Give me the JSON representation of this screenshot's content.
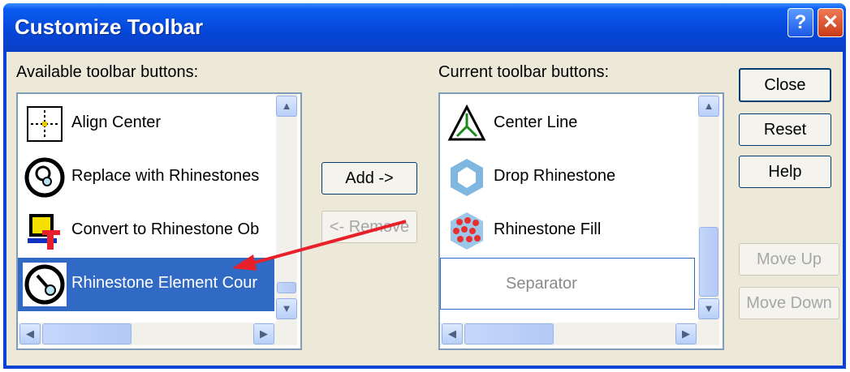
{
  "window": {
    "title": "Customize Toolbar",
    "help_glyph": "?",
    "close_glyph": "✕"
  },
  "available": {
    "label": "Available toolbar buttons:",
    "items": [
      {
        "label": "Align Center",
        "icon": "align-center-icon"
      },
      {
        "label": "Replace with Rhinestones",
        "icon": "replace-rhinestones-icon"
      },
      {
        "label": "Convert to Rhinestone Ob",
        "icon": "convert-rhinestone-icon"
      },
      {
        "label": "Rhinestone Element Cour",
        "icon": "rhinestone-element-icon",
        "selected": true
      }
    ]
  },
  "current": {
    "label": "Current toolbar buttons:",
    "items": [
      {
        "label": "Center Line",
        "icon": "center-line-icon"
      },
      {
        "label": "Drop Rhinestone",
        "icon": "drop-rhinestone-icon"
      },
      {
        "label": "Rhinestone Fill",
        "icon": "rhinestone-fill-icon"
      },
      {
        "label": "Separator",
        "icon": ""
      }
    ]
  },
  "buttons": {
    "add": "Add ->",
    "remove": "<- Remove",
    "close": "Close",
    "reset": "Reset",
    "help": "Help",
    "move_up": "Move Up",
    "move_down": "Move Down"
  },
  "colors": {
    "selection": "#316ac5",
    "annotation_arrow": "#e8202a",
    "titlebar": "#0646d8"
  }
}
